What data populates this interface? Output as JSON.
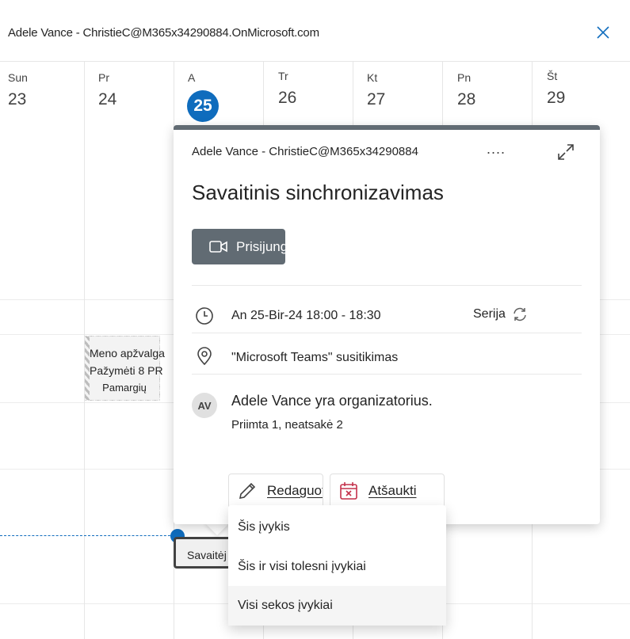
{
  "header": {
    "title": "Adele Vance - ChristieC@M365x34290884.OnMicrosoft.com"
  },
  "week": {
    "days": [
      {
        "name": "Sun",
        "num": "23"
      },
      {
        "name": "Pr",
        "num": "24"
      },
      {
        "name": "A",
        "num": "25"
      },
      {
        "name": "Tr",
        "num": "26"
      },
      {
        "name": "Kt",
        "num": "27"
      },
      {
        "name": "Pn",
        "num": "28"
      },
      {
        "name": "Št",
        "num": "29"
      }
    ]
  },
  "events": {
    "meno": {
      "line1": "Meno apžvalga",
      "line2": "Pažymėti 8 PR",
      "line3": "Pamargių"
    },
    "selected": {
      "label": "Savaitėj"
    }
  },
  "popup": {
    "calendar": "Adele Vance - ChristieC@M365x34290884",
    "more": "....",
    "title": "Savaitinis sinchronizavimas",
    "join_label": "Prisijungti",
    "time": "An 25-Bir-24 18:00 - 18:30",
    "series_label": "Serija",
    "location": "\"Microsoft Teams\" susitikimas",
    "avatar_initials": "AV",
    "organizer": "Adele Vance yra organizatorius.",
    "responses": "Priimta 1, neatsakė 2",
    "edit_label": "Redaguoti",
    "cancel_label": "Atšaukti"
  },
  "menu": {
    "items": [
      {
        "label": "Šis įvykis"
      },
      {
        "label": "Šis ir visi tolesni įvykiai"
      },
      {
        "label": "Visi sekos įvykiai"
      }
    ]
  },
  "colors": {
    "accent": "#0f6cbd",
    "popup_bar": "#616b73"
  }
}
